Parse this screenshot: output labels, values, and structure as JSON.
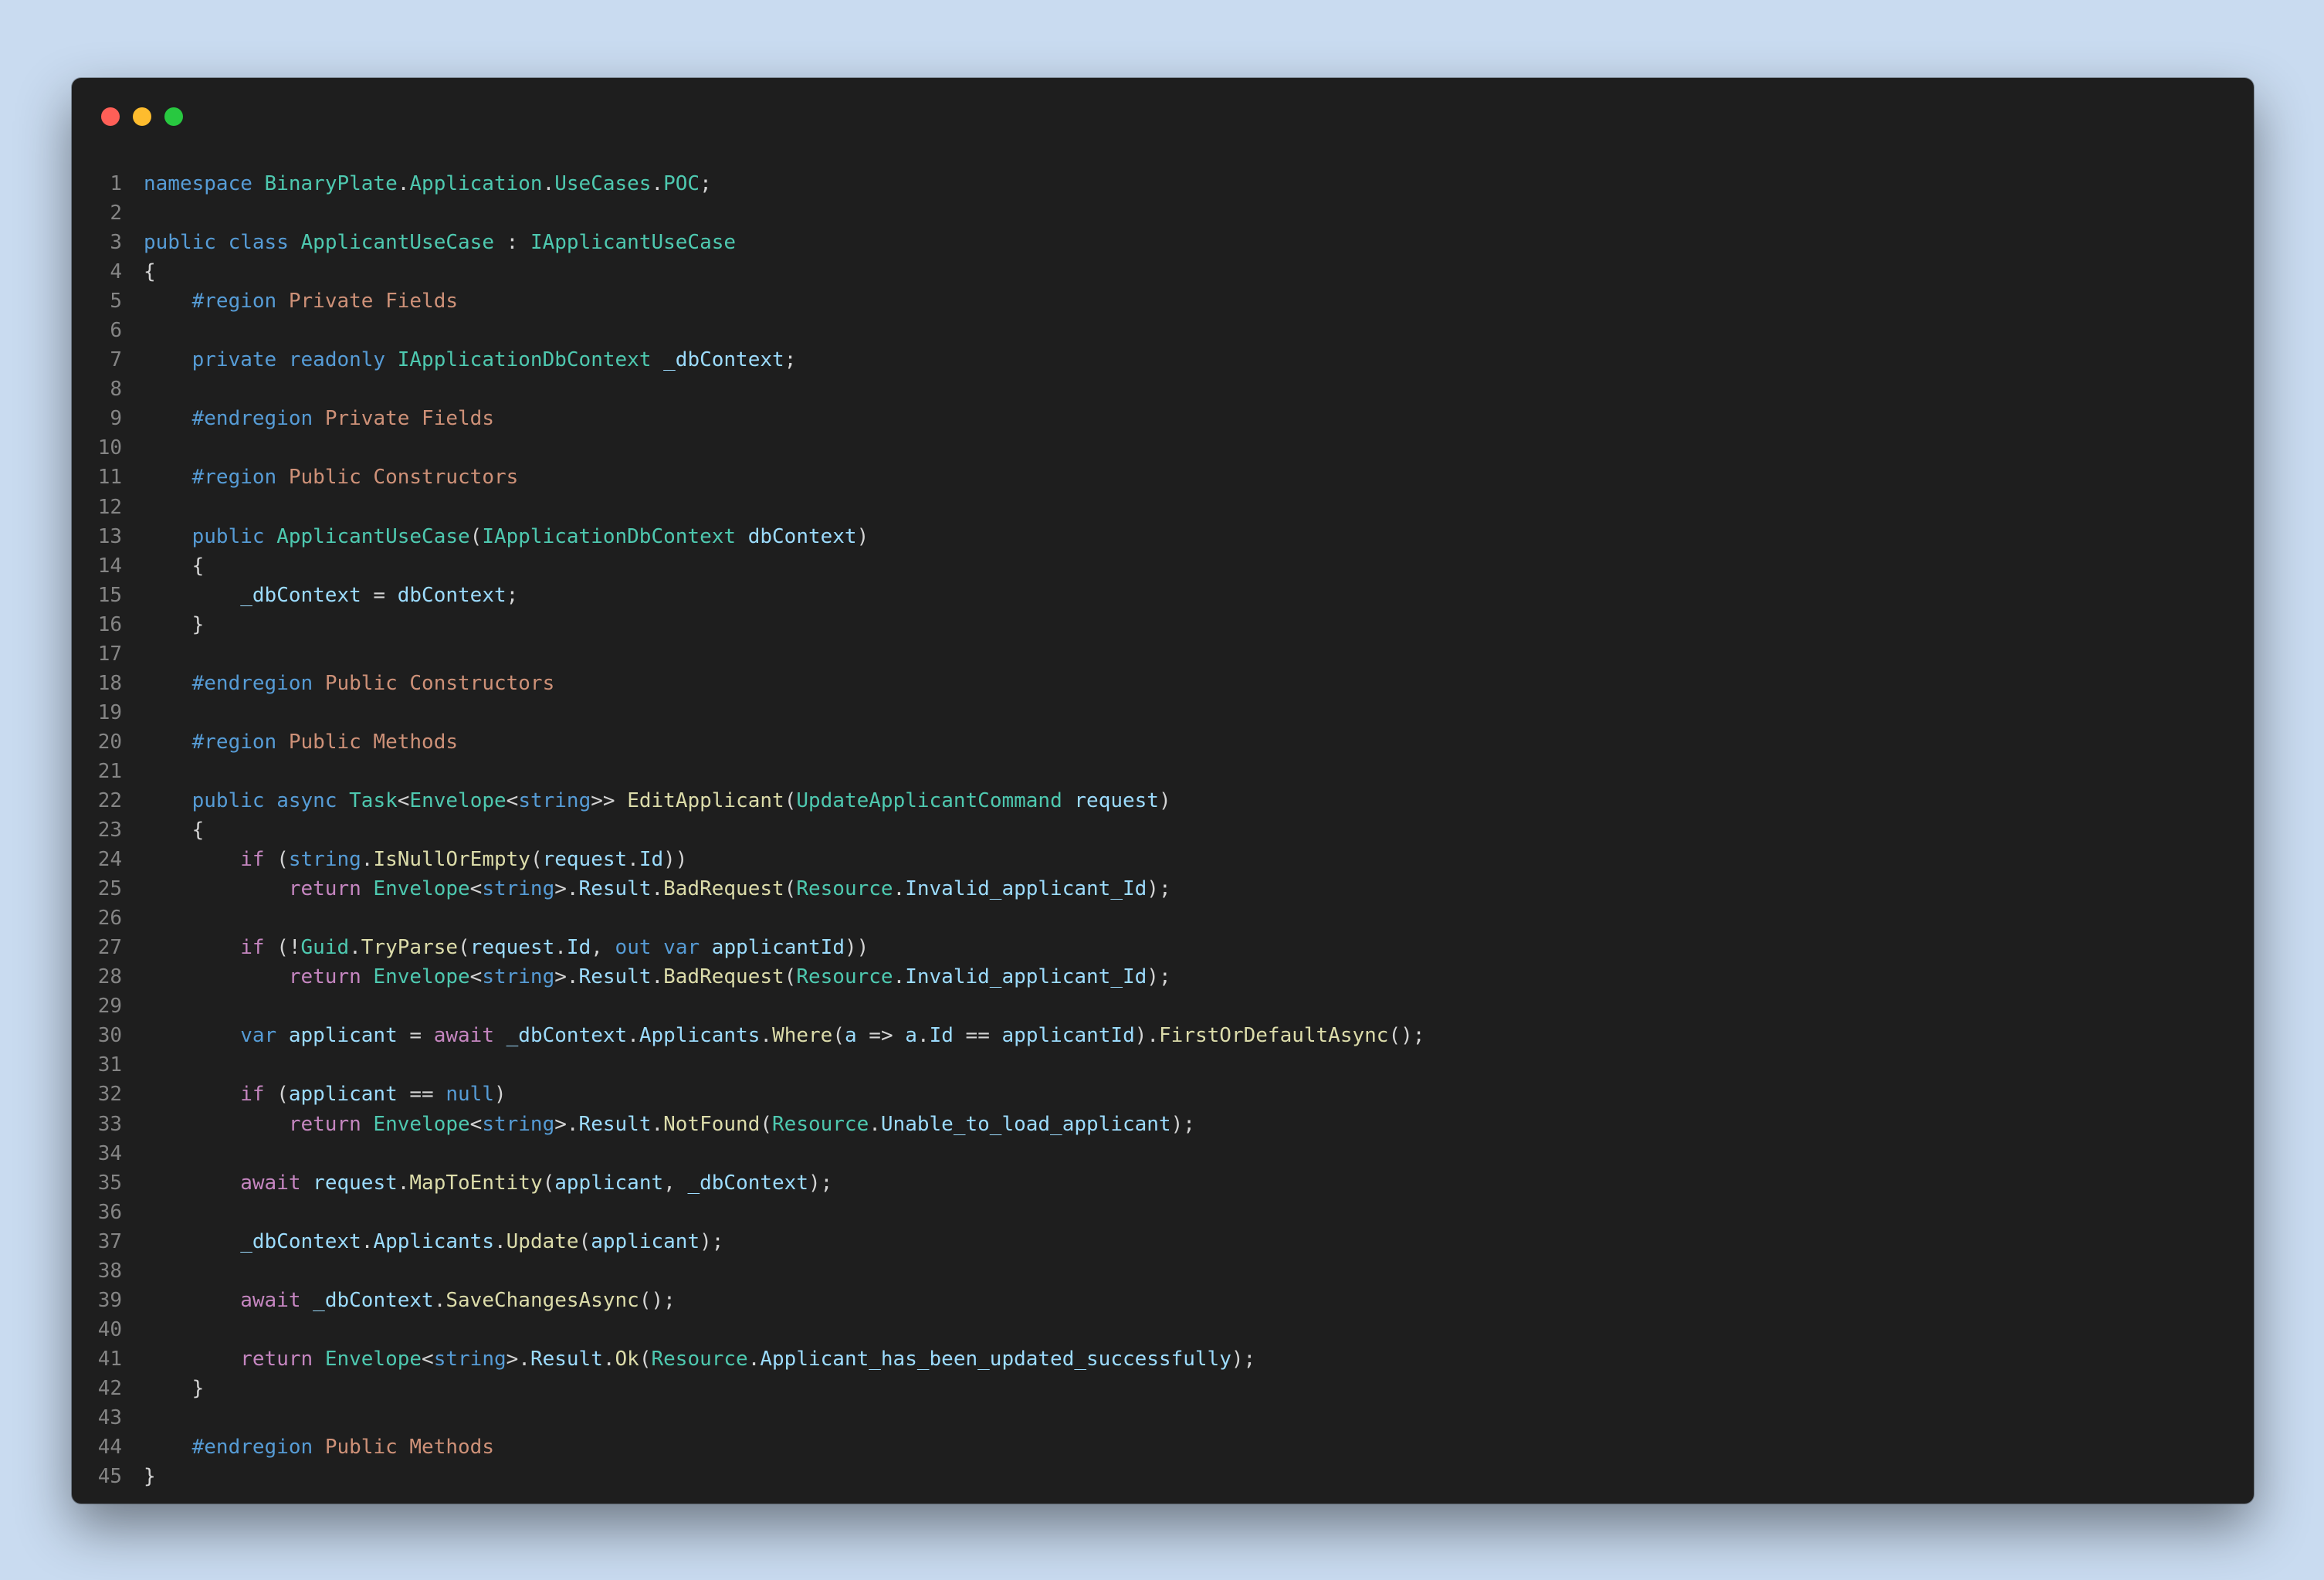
{
  "window": {
    "controls": [
      "close",
      "minimize",
      "maximize"
    ],
    "colors": {
      "close": "#ff5f57",
      "minimize": "#febc2e",
      "maximize": "#28c840",
      "background": "#1e1e1e"
    }
  },
  "code": {
    "language": "csharp",
    "lines": [
      [
        [
          "k",
          "namespace"
        ],
        [
          "p",
          " "
        ],
        [
          "t",
          "BinaryPlate"
        ],
        [
          "p",
          "."
        ],
        [
          "t",
          "Application"
        ],
        [
          "p",
          "."
        ],
        [
          "t",
          "UseCases"
        ],
        [
          "p",
          "."
        ],
        [
          "t",
          "POC"
        ],
        [
          "p",
          ";"
        ]
      ],
      [],
      [
        [
          "k",
          "public"
        ],
        [
          "p",
          " "
        ],
        [
          "k",
          "class"
        ],
        [
          "p",
          " "
        ],
        [
          "t",
          "ApplicantUseCase"
        ],
        [
          "p",
          " : "
        ],
        [
          "t",
          "IApplicantUseCase"
        ]
      ],
      [
        [
          "p",
          "{"
        ]
      ],
      [
        [
          "p",
          "    "
        ],
        [
          "k",
          "#region"
        ],
        [
          "p",
          " "
        ],
        [
          "r",
          "Private Fields"
        ]
      ],
      [],
      [
        [
          "p",
          "    "
        ],
        [
          "k",
          "private"
        ],
        [
          "p",
          " "
        ],
        [
          "k",
          "readonly"
        ],
        [
          "p",
          " "
        ],
        [
          "t",
          "IApplicationDbContext"
        ],
        [
          "p",
          " "
        ],
        [
          "v",
          "_dbContext"
        ],
        [
          "p",
          ";"
        ]
      ],
      [],
      [
        [
          "p",
          "    "
        ],
        [
          "k",
          "#endregion"
        ],
        [
          "p",
          " "
        ],
        [
          "r",
          "Private Fields"
        ]
      ],
      [],
      [
        [
          "p",
          "    "
        ],
        [
          "k",
          "#region"
        ],
        [
          "p",
          " "
        ],
        [
          "r",
          "Public Constructors"
        ]
      ],
      [],
      [
        [
          "p",
          "    "
        ],
        [
          "k",
          "public"
        ],
        [
          "p",
          " "
        ],
        [
          "t",
          "ApplicantUseCase"
        ],
        [
          "p",
          "("
        ],
        [
          "t",
          "IApplicationDbContext"
        ],
        [
          "p",
          " "
        ],
        [
          "v",
          "dbContext"
        ],
        [
          "p",
          ")"
        ]
      ],
      [
        [
          "p",
          "    {"
        ]
      ],
      [
        [
          "p",
          "        "
        ],
        [
          "v",
          "_dbContext"
        ],
        [
          "p",
          " = "
        ],
        [
          "v",
          "dbContext"
        ],
        [
          "p",
          ";"
        ]
      ],
      [
        [
          "p",
          "    }"
        ]
      ],
      [],
      [
        [
          "p",
          "    "
        ],
        [
          "k",
          "#endregion"
        ],
        [
          "p",
          " "
        ],
        [
          "r",
          "Public Constructors"
        ]
      ],
      [],
      [
        [
          "p",
          "    "
        ],
        [
          "k",
          "#region"
        ],
        [
          "p",
          " "
        ],
        [
          "r",
          "Public Methods"
        ]
      ],
      [],
      [
        [
          "p",
          "    "
        ],
        [
          "k",
          "public"
        ],
        [
          "p",
          " "
        ],
        [
          "k",
          "async"
        ],
        [
          "p",
          " "
        ],
        [
          "t",
          "Task"
        ],
        [
          "p",
          "<"
        ],
        [
          "t",
          "Envelope"
        ],
        [
          "p",
          "<"
        ],
        [
          "k",
          "string"
        ],
        [
          "p",
          ">> "
        ],
        [
          "f",
          "EditApplicant"
        ],
        [
          "p",
          "("
        ],
        [
          "t",
          "UpdateApplicantCommand"
        ],
        [
          "p",
          " "
        ],
        [
          "v",
          "request"
        ],
        [
          "p",
          ")"
        ]
      ],
      [
        [
          "p",
          "    {"
        ]
      ],
      [
        [
          "p",
          "        "
        ],
        [
          "c",
          "if"
        ],
        [
          "p",
          " ("
        ],
        [
          "k",
          "string"
        ],
        [
          "p",
          "."
        ],
        [
          "f",
          "IsNullOrEmpty"
        ],
        [
          "p",
          "("
        ],
        [
          "v",
          "request"
        ],
        [
          "p",
          "."
        ],
        [
          "v",
          "Id"
        ],
        [
          "p",
          "))"
        ]
      ],
      [
        [
          "p",
          "            "
        ],
        [
          "c",
          "return"
        ],
        [
          "p",
          " "
        ],
        [
          "t",
          "Envelope"
        ],
        [
          "p",
          "<"
        ],
        [
          "k",
          "string"
        ],
        [
          "p",
          ">."
        ],
        [
          "v",
          "Result"
        ],
        [
          "p",
          "."
        ],
        [
          "f",
          "BadRequest"
        ],
        [
          "p",
          "("
        ],
        [
          "t",
          "Resource"
        ],
        [
          "p",
          "."
        ],
        [
          "v",
          "Invalid_applicant_Id"
        ],
        [
          "p",
          ");"
        ]
      ],
      [],
      [
        [
          "p",
          "        "
        ],
        [
          "c",
          "if"
        ],
        [
          "p",
          " (!"
        ],
        [
          "t",
          "Guid"
        ],
        [
          "p",
          "."
        ],
        [
          "f",
          "TryParse"
        ],
        [
          "p",
          "("
        ],
        [
          "v",
          "request"
        ],
        [
          "p",
          "."
        ],
        [
          "v",
          "Id"
        ],
        [
          "p",
          ", "
        ],
        [
          "k",
          "out"
        ],
        [
          "p",
          " "
        ],
        [
          "k",
          "var"
        ],
        [
          "p",
          " "
        ],
        [
          "v",
          "applicantId"
        ],
        [
          "p",
          "))"
        ]
      ],
      [
        [
          "p",
          "            "
        ],
        [
          "c",
          "return"
        ],
        [
          "p",
          " "
        ],
        [
          "t",
          "Envelope"
        ],
        [
          "p",
          "<"
        ],
        [
          "k",
          "string"
        ],
        [
          "p",
          ">."
        ],
        [
          "v",
          "Result"
        ],
        [
          "p",
          "."
        ],
        [
          "f",
          "BadRequest"
        ],
        [
          "p",
          "("
        ],
        [
          "t",
          "Resource"
        ],
        [
          "p",
          "."
        ],
        [
          "v",
          "Invalid_applicant_Id"
        ],
        [
          "p",
          ");"
        ]
      ],
      [],
      [
        [
          "p",
          "        "
        ],
        [
          "k",
          "var"
        ],
        [
          "p",
          " "
        ],
        [
          "v",
          "applicant"
        ],
        [
          "p",
          " = "
        ],
        [
          "c",
          "await"
        ],
        [
          "p",
          " "
        ],
        [
          "v",
          "_dbContext"
        ],
        [
          "p",
          "."
        ],
        [
          "v",
          "Applicants"
        ],
        [
          "p",
          "."
        ],
        [
          "f",
          "Where"
        ],
        [
          "p",
          "("
        ],
        [
          "v",
          "a"
        ],
        [
          "p",
          " => "
        ],
        [
          "v",
          "a"
        ],
        [
          "p",
          "."
        ],
        [
          "v",
          "Id"
        ],
        [
          "p",
          " == "
        ],
        [
          "v",
          "applicantId"
        ],
        [
          "p",
          ")."
        ],
        [
          "f",
          "FirstOrDefaultAsync"
        ],
        [
          "p",
          "();"
        ]
      ],
      [],
      [
        [
          "p",
          "        "
        ],
        [
          "c",
          "if"
        ],
        [
          "p",
          " ("
        ],
        [
          "v",
          "applicant"
        ],
        [
          "p",
          " == "
        ],
        [
          "k",
          "null"
        ],
        [
          "p",
          ")"
        ]
      ],
      [
        [
          "p",
          "            "
        ],
        [
          "c",
          "return"
        ],
        [
          "p",
          " "
        ],
        [
          "t",
          "Envelope"
        ],
        [
          "p",
          "<"
        ],
        [
          "k",
          "string"
        ],
        [
          "p",
          ">."
        ],
        [
          "v",
          "Result"
        ],
        [
          "p",
          "."
        ],
        [
          "f",
          "NotFound"
        ],
        [
          "p",
          "("
        ],
        [
          "t",
          "Resource"
        ],
        [
          "p",
          "."
        ],
        [
          "v",
          "Unable_to_load_applicant"
        ],
        [
          "p",
          ");"
        ]
      ],
      [],
      [
        [
          "p",
          "        "
        ],
        [
          "c",
          "await"
        ],
        [
          "p",
          " "
        ],
        [
          "v",
          "request"
        ],
        [
          "p",
          "."
        ],
        [
          "f",
          "MapToEntity"
        ],
        [
          "p",
          "("
        ],
        [
          "v",
          "applicant"
        ],
        [
          "p",
          ", "
        ],
        [
          "v",
          "_dbContext"
        ],
        [
          "p",
          ");"
        ]
      ],
      [],
      [
        [
          "p",
          "        "
        ],
        [
          "v",
          "_dbContext"
        ],
        [
          "p",
          "."
        ],
        [
          "v",
          "Applicants"
        ],
        [
          "p",
          "."
        ],
        [
          "f",
          "Update"
        ],
        [
          "p",
          "("
        ],
        [
          "v",
          "applicant"
        ],
        [
          "p",
          ");"
        ]
      ],
      [],
      [
        [
          "p",
          "        "
        ],
        [
          "c",
          "await"
        ],
        [
          "p",
          " "
        ],
        [
          "v",
          "_dbContext"
        ],
        [
          "p",
          "."
        ],
        [
          "f",
          "SaveChangesAsync"
        ],
        [
          "p",
          "();"
        ]
      ],
      [],
      [
        [
          "p",
          "        "
        ],
        [
          "c",
          "return"
        ],
        [
          "p",
          " "
        ],
        [
          "t",
          "Envelope"
        ],
        [
          "p",
          "<"
        ],
        [
          "k",
          "string"
        ],
        [
          "p",
          ">."
        ],
        [
          "v",
          "Result"
        ],
        [
          "p",
          "."
        ],
        [
          "f",
          "Ok"
        ],
        [
          "p",
          "("
        ],
        [
          "t",
          "Resource"
        ],
        [
          "p",
          "."
        ],
        [
          "v",
          "Applicant_has_been_updated_successfully"
        ],
        [
          "p",
          ");"
        ]
      ],
      [
        [
          "p",
          "    }"
        ]
      ],
      [],
      [
        [
          "p",
          "    "
        ],
        [
          "k",
          "#endregion"
        ],
        [
          "p",
          " "
        ],
        [
          "r",
          "Public Methods"
        ]
      ],
      [
        [
          "p",
          "}"
        ]
      ]
    ]
  }
}
